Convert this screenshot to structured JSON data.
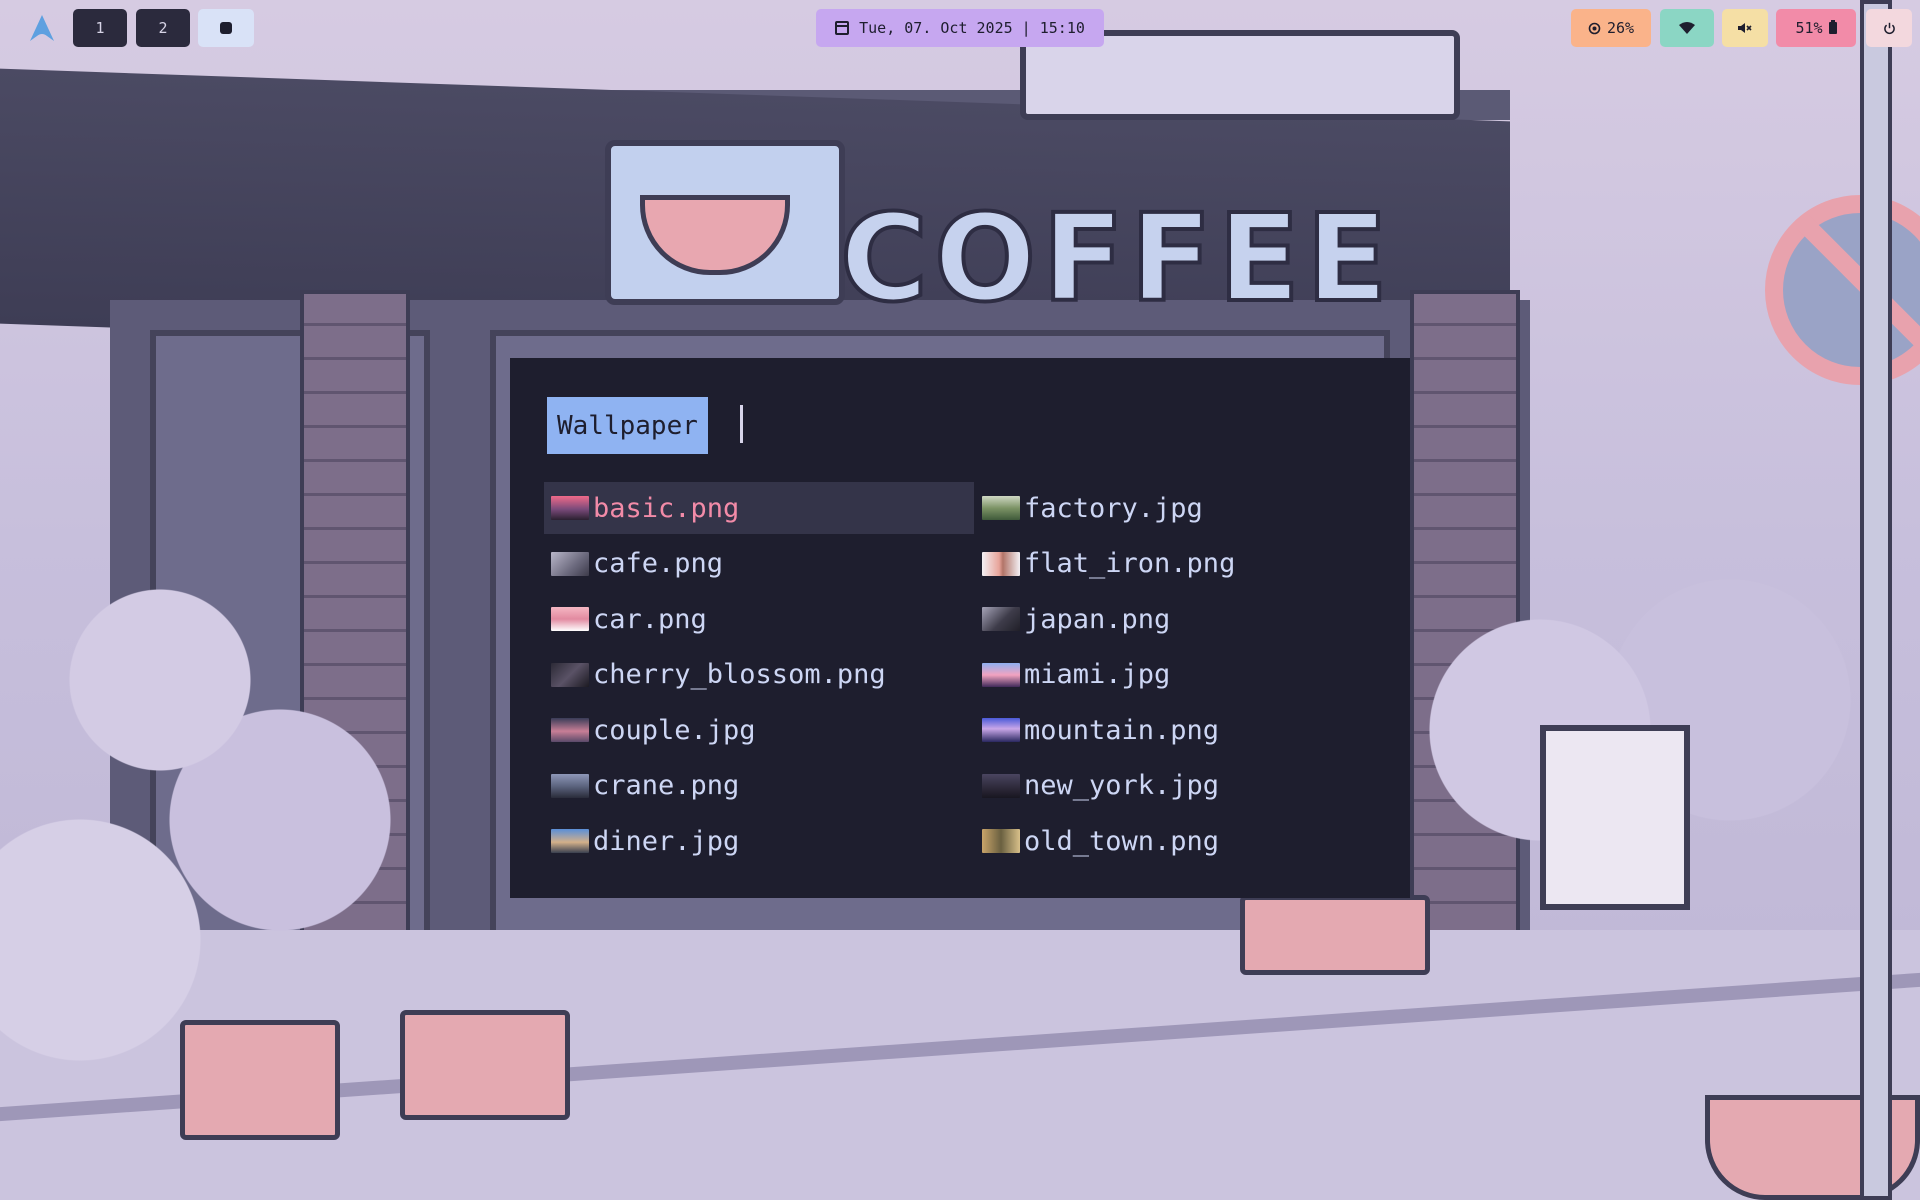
{
  "topbar": {
    "workspaces": [
      "1",
      "2"
    ],
    "clock": "Tue, 07. Oct 2025 | 15:10",
    "cpu": "26%",
    "battery": "51%"
  },
  "launcher": {
    "prompt": "Wallpaper",
    "selected_index": 0,
    "items": [
      {
        "name": "basic.png",
        "thumb": "linear-gradient(180deg,#f06a8a 0%,#7a4a7a 55%,#2a2030 100%)"
      },
      {
        "name": "cafe.png",
        "thumb": "linear-gradient(135deg,#b9b6c9 0%,#6c6a7e 60%,#3c3a4a 100%)"
      },
      {
        "name": "car.png",
        "thumb": "linear-gradient(180deg,#f5b7c3 0%,#e28aa0 50%,#ffffff 100%)"
      },
      {
        "name": "cherry_blossom.png",
        "thumb": "linear-gradient(135deg,#2c2a36 0%,#5a5266 50%,#1c1a22 100%)"
      },
      {
        "name": "couple.jpg",
        "thumb": "linear-gradient(180deg,#3a3c58 0%,#c87e96 55%,#5a4a6a 100%)"
      },
      {
        "name": "crane.png",
        "thumb": "linear-gradient(180deg,#8e97b8 0%,#5d6580 50%,#2a2c3a 100%)"
      },
      {
        "name": "diner.jpg",
        "thumb": "linear-gradient(180deg,#5a8fd8 0%,#d3b08a 55%,#3a4050 100%)"
      },
      {
        "name": "factory.jpg",
        "thumb": "linear-gradient(180deg,#cfd8c4 0%,#7d9466 50%,#3f5a3a 100%)"
      },
      {
        "name": "flat_iron.png",
        "thumb": "linear-gradient(90deg,#f3f0f4 0%,#e8a49a 45%,#b27468 55%,#f3f0f4 100%)"
      },
      {
        "name": "japan.png",
        "thumb": "linear-gradient(135deg,#a6a4b8 0%,#3e3c4a 55%,#201f28 100%)"
      },
      {
        "name": "miami.jpg",
        "thumb": "linear-gradient(180deg,#8fb0f0 0%,#f2a3c0 50%,#402a5a 100%)"
      },
      {
        "name": "mountain.png",
        "thumb": "linear-gradient(180deg,#4a5ad8 0%,#c9a7e8 45%,#2a2860 100%)"
      },
      {
        "name": "new_york.jpg",
        "thumb": "linear-gradient(180deg,#4a4560 0%,#2c2838 60%,#181620 100%)"
      },
      {
        "name": "old_town.png",
        "thumb": "linear-gradient(90deg,#c9a46a 0%,#6a6040 50%,#d8c08a 100%)"
      }
    ]
  }
}
